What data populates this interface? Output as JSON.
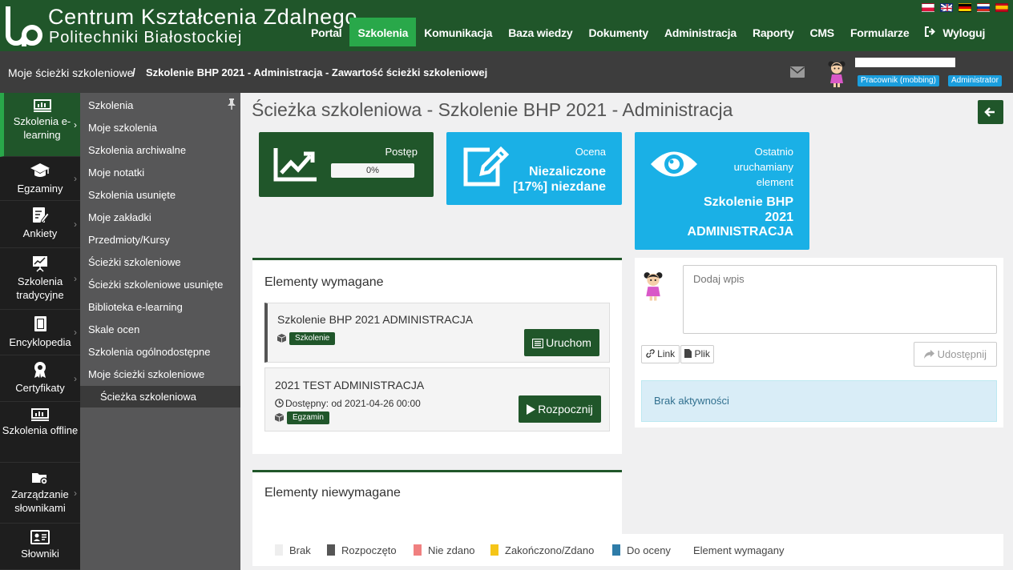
{
  "header": {
    "logo_line1": "Centrum Kształcenia Zdalnego",
    "logo_line2": "Politechniki Białostockiej",
    "languages": [
      "pl",
      "en",
      "de",
      "ru",
      "es"
    ],
    "nav": [
      {
        "label": "Portal"
      },
      {
        "label": "Szkolenia",
        "active": true
      },
      {
        "label": "Komunikacja"
      },
      {
        "label": "Baza wiedzy"
      },
      {
        "label": "Dokumenty"
      },
      {
        "label": "Administracja"
      },
      {
        "label": "Raporty"
      },
      {
        "label": "CMS"
      },
      {
        "label": "Formularze"
      },
      {
        "label": "Wyloguj",
        "icon": "logout-icon"
      }
    ]
  },
  "breadcrumb": {
    "items": [
      "Moje ścieżki szkoleniowe",
      "Szkolenie BHP 2021 - Administracja - Zawartość ścieżki szkoleniowej"
    ],
    "separator": "/"
  },
  "user": {
    "roles": [
      "Pracownik (mobbing)",
      "Administrator"
    ]
  },
  "sidebar": {
    "items": [
      {
        "label": "Szkolenia e-learning",
        "icon": "elearning-board-icon",
        "active": true
      },
      {
        "label": "Egzaminy",
        "icon": "graduation-cap-icon"
      },
      {
        "label": "Ankiety",
        "icon": "survey-edit-icon"
      },
      {
        "label": "Szkolenia tradycyjne",
        "icon": "presentation-chart-icon"
      },
      {
        "label": "Encyklopedia",
        "icon": "book-icon"
      },
      {
        "label": "Certyfikaty",
        "icon": "award-icon"
      },
      {
        "label": "Szkolenia offline",
        "icon": "offline-board-icon"
      },
      {
        "label": "Zarządzanie słownikami",
        "icon": "folder-gear-icon"
      },
      {
        "label": "Słowniki",
        "icon": "id-card-icon"
      }
    ]
  },
  "submenu": {
    "items": [
      "Szkolenia",
      "Moje szkolenia",
      "Szkolenia archiwalne",
      "Moje notatki",
      "Szkolenia usunięte",
      "Moje zakładki",
      "Przedmioty/Kursy",
      "Ścieżki szkoleniowe",
      "Ścieżki szkoleniowe usunięte",
      "Biblioteka e-learning",
      "Skale ocen",
      "Szkolenia ogólnodostępne",
      "Moje ścieżki szkoleniowe",
      "Ścieżka szkoleniowa"
    ],
    "active_index": 13
  },
  "page": {
    "title": "Ścieżka szkoleniowa - Szkolenie BHP 2021 - Administracja"
  },
  "tiles": {
    "progress": {
      "label": "Postęp",
      "value_text": "0%",
      "value": 0,
      "color": "#20562a"
    },
    "grade": {
      "label": "Ocena",
      "value_line1": "Niezaliczone",
      "value_line2": "[17%] niezdane",
      "color": "#1ab0e6"
    },
    "last": {
      "label_line1": "Ostatnio",
      "label_line2": "uruchamiany",
      "label_line3": "element",
      "value_line1": "Szkolenie BHP",
      "value_line2": "2021",
      "value_line3": "ADMINISTRACJA",
      "color": "#1ab0e6"
    }
  },
  "required": {
    "title": "Elementy wymagane",
    "items": [
      {
        "title": "Szkolenie BHP 2021 ADMINISTRACJA",
        "type": "Szkolenie",
        "action": "Uruchom",
        "action_icon": "list-icon"
      },
      {
        "title": "2021 TEST ADMINISTRACJA",
        "available": "Dostępny: od 2021-04-26 00:00",
        "type": "Egzamin",
        "action": "Rozpocznij",
        "action_icon": "play-icon"
      }
    ]
  },
  "optional": {
    "title": "Elementy niewymagane"
  },
  "wall": {
    "placeholder": "Dodaj wpis",
    "link_label": "Link",
    "file_label": "Plik",
    "share_label": "Udostępnij",
    "empty_text": "Brak aktywności"
  },
  "legend": [
    {
      "label": "Brak",
      "color": "#eeeeee"
    },
    {
      "label": "Rozpoczęto",
      "color": "#555555"
    },
    {
      "label": "Nie zdano",
      "color": "#f08080"
    },
    {
      "label": "Zakończono/Zdano",
      "color": "#f5c518"
    },
    {
      "label": "Do oceny",
      "color": "#2e7ca8"
    },
    {
      "label": "Element wymagany",
      "color": ""
    }
  ]
}
